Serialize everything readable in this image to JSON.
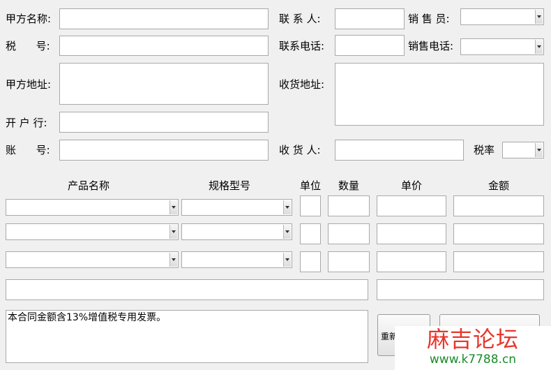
{
  "party_a": {
    "name_label": "甲方名称:",
    "tax_label": "税      号:",
    "address_label": "甲方地址:",
    "bank_label": "开 户 行:",
    "account_label": "账      号:"
  },
  "contact": {
    "contact_label": "联 系 人:",
    "phone_label": "联系电话:",
    "ship_address_label": "收货地址:",
    "receiver_label": "收 货 人:"
  },
  "sales": {
    "salesperson_label": "销 售 员:",
    "sales_phone_label": "销售电话:",
    "tax_rate_label": "税率"
  },
  "items": {
    "headers": {
      "product": "产品名称",
      "spec": "规格型号",
      "unit": "单位",
      "qty": "数量",
      "price": "单价",
      "amount": "金额"
    }
  },
  "note": {
    "text": "本合同金额含13%增值税专用发票。"
  },
  "buttons": {
    "reset_partial": "重新"
  },
  "watermark": {
    "title": "麻吉论坛",
    "url": "www.k7788.cn"
  }
}
